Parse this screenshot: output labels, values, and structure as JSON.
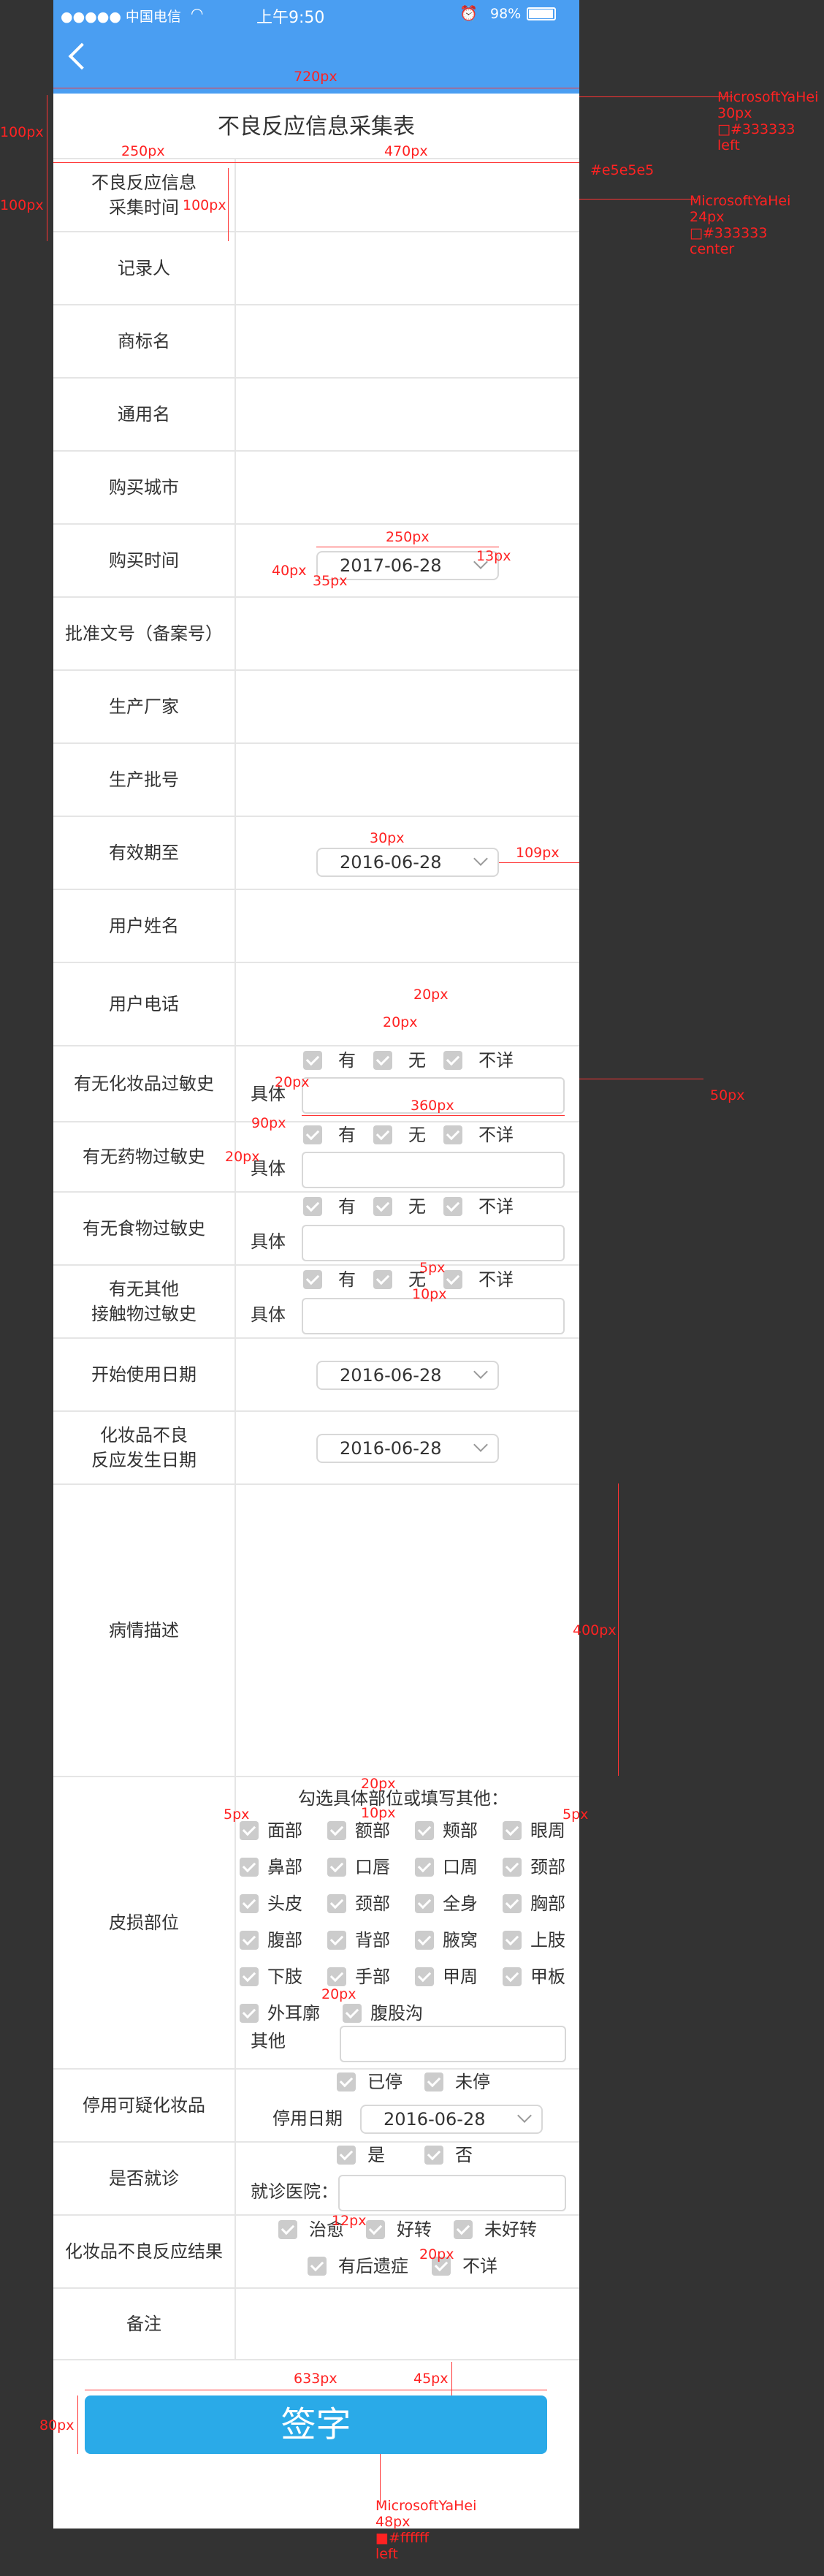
{
  "status_bar": {
    "carrier": "●●●●● 中国电信",
    "time": "上午9:50",
    "battery": "98%"
  },
  "page_title": "不良反应信息采集表",
  "rows": {
    "collect_time": "不良反应信息\n采集时间",
    "recorder": "记录人",
    "brand": "商标名",
    "generic": "通用名",
    "city": "购买城市",
    "purchase_time": "购买时间",
    "approval": "批准文号（备案号）",
    "manufacturer": "生产厂家",
    "batch": "生产批号",
    "expiry": "有效期至",
    "user_name": "用户姓名",
    "user_phone": "用户电话",
    "cosmetic_allergy": "有无化妆品过敏史",
    "drug_allergy": "有无药物过敏史",
    "food_allergy": "有无食物过敏史",
    "contact_allergy": "有无其他\n接触物过敏史",
    "start_date": "开始使用日期",
    "reaction_date": "化妆品不良\n反应发生日期",
    "description": "病情描述",
    "damage_part": "皮损部位",
    "stop_use": "停用可疑化妆品",
    "visit": "是否就诊",
    "result": "化妆品不良反应结果",
    "remark": "备注"
  },
  "dates": {
    "purchase": "2017-06-28",
    "expiry": "2016-06-28",
    "start": "2016-06-28",
    "reaction": "2016-06-28",
    "stop": "2016-06-28"
  },
  "opts": {
    "have": "有",
    "none": "无",
    "unknown": "不详",
    "specific": "具体"
  },
  "body_parts": {
    "hint": "勾选具体部位或填写其他：",
    "items": [
      "面部",
      "额部",
      "颊部",
      "眼周",
      "鼻部",
      "口唇",
      "口周",
      "颈部",
      "头皮",
      "颈部",
      "全身",
      "胸部",
      "腹部",
      "背部",
      "腋窝",
      "上肢",
      "下肢",
      "手部",
      "甲周",
      "甲板",
      "外耳廓",
      "腹股沟"
    ],
    "other": "其他"
  },
  "stop": {
    "stopped": "已停",
    "not_stopped": "未停",
    "date_label": "停用日期"
  },
  "visit": {
    "yes": "是",
    "no": "否",
    "hospital": "就诊医院："
  },
  "result": {
    "cured": "治愈",
    "better": "好转",
    "not_better": "未好转",
    "sequelae": "有后遗症",
    "unknown": "不详"
  },
  "sign_button": "签字",
  "annotations": {
    "w720": "720px",
    "w250": "250px",
    "w470": "470px",
    "h100a": "100px",
    "h100b": "100px",
    "h100c": "100px",
    "spec_title": "MicrosoftYaHei\n30px\n□#333333\nleft",
    "spec_border": "#e5e5e5",
    "spec_label": "MicrosoftYaHei\n24px\n□#333333\ncenter",
    "d250": "250px",
    "d13": "13px",
    "d40": "40px",
    "d35": "35px",
    "d30": "30px",
    "d109": "109px",
    "c20a": "20px",
    "c20b": "20px",
    "c20c": "20px",
    "c50": "50px",
    "c360": "360px",
    "c90": "90px",
    "c20d": "20px",
    "c5a": "5px",
    "c10a": "10px",
    "h400": "400px",
    "p20a": "20px",
    "p10": "10px",
    "p5a": "5px",
    "p5b": "5px",
    "p20b": "20px",
    "r12": "12px",
    "r20": "20px",
    "b633": "633px",
    "b45": "45px",
    "b80": "80px",
    "spec_button": "MicrosoftYaHei\n48px\n■#ffffff\nleft"
  }
}
